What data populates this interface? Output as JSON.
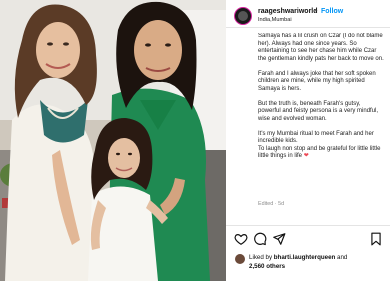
{
  "post": {
    "username": "raageshwariworld",
    "separator": "•",
    "follow_label": "Follow",
    "location": "India,Mumbai"
  },
  "caption": {
    "p1": "Samaya has a lil crush on Czar (I do not blame her). Always had one since years. So entertaining to see her chase him while Czar the gentleman kindly pats her back to move on.",
    "p2": "Farah and I always joke that her soft spoken children are mine, while my high spirited Samaya is hers.",
    "p3": "But the truth is, beneath Farah's gutsy, powerful and feisty persona is a very mindful, wise and evolved woman.",
    "p4": "It's my Mumbai ritual to meet Farah and her incredible kids.",
    "p5": "To laugh non stop and be grateful for little little little things in life",
    "heart": "❤",
    "edited": "Edited · 5d"
  },
  "likes": {
    "prefix": "Liked by ",
    "user": "bharti.laughterqueen",
    "and": " and",
    "count": "2,560 others"
  },
  "icons": {
    "like": "heart-icon",
    "comment": "comment-icon",
    "share": "share-icon",
    "save": "bookmark-icon"
  }
}
